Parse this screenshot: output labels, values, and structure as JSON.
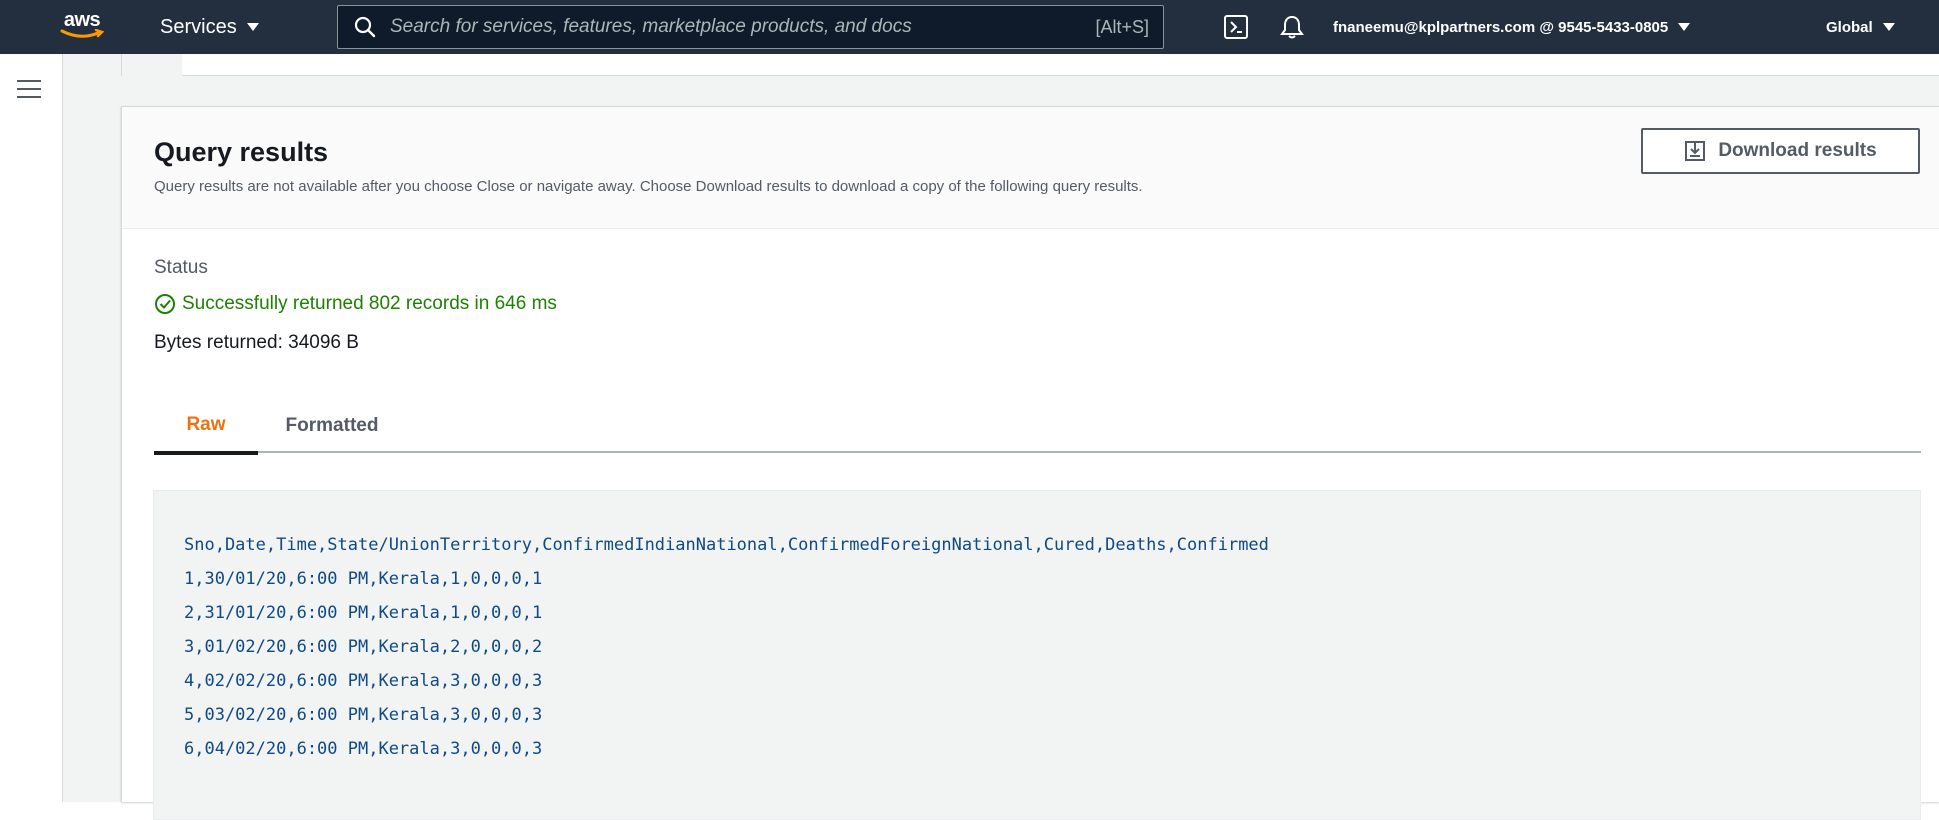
{
  "topnav": {
    "logo_text": "aws",
    "services_label": "Services",
    "search": {
      "placeholder": "Search for services, features, marketplace products, and docs",
      "shortcut": "[Alt+S]"
    },
    "icons": [
      "cloudshell-icon",
      "bell-icon"
    ],
    "account_label": "fnaneemu@kplpartners.com @ 9545-5433-0805",
    "region_label": "Global"
  },
  "card": {
    "title": "Query results",
    "description": "Query results are not available after you choose Close or navigate away. Choose Download results to download a copy of the following query results.",
    "download_label": "Download results",
    "status_label": "Status",
    "status_text": "Successfully returned 802 records in 646 ms",
    "bytes_text": "Bytes returned: 34096 B",
    "tabs": [
      {
        "label": "Raw",
        "active": true
      },
      {
        "label": "Formatted",
        "active": false
      }
    ],
    "raw_lines": [
      "Sno,Date,Time,State/UnionTerritory,ConfirmedIndianNational,ConfirmedForeignNational,Cured,Deaths,Confirmed",
      "1,30/01/20,6:00 PM,Kerala,1,0,0,0,1",
      "2,31/01/20,6:00 PM,Kerala,1,0,0,0,1",
      "3,01/02/20,6:00 PM,Kerala,2,0,0,0,2",
      "4,02/02/20,6:00 PM,Kerala,3,0,0,0,3",
      "5,03/02/20,6:00 PM,Kerala,3,0,0,0,3",
      "6,04/02/20,6:00 PM,Kerala,3,0,0,0,3"
    ]
  },
  "colors": {
    "nav_bg": "#232f3e",
    "success": "#1d8102",
    "active_tab": "#ec7211",
    "code_text": "#0f4a85"
  }
}
